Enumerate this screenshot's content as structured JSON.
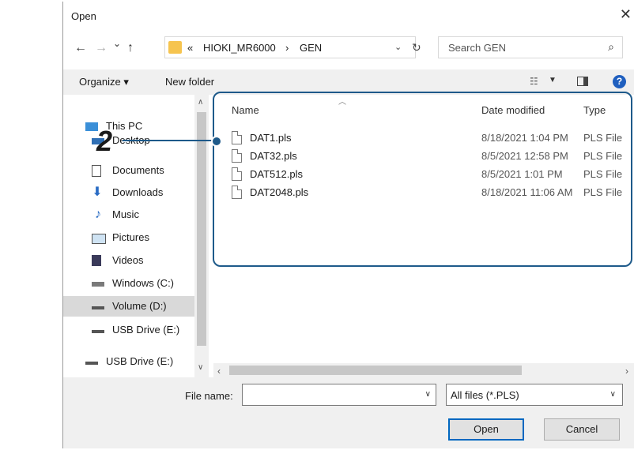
{
  "window": {
    "title": "Open",
    "close_glyph": "✕"
  },
  "nav": {
    "back": "←",
    "forward": "→",
    "recent": "⌄",
    "up": "↑"
  },
  "address": {
    "overflow": "«",
    "crumbs": [
      "HIOKI_MR6000",
      "GEN"
    ],
    "separator": "›",
    "dropdown": "⌄",
    "refresh": "↻"
  },
  "search": {
    "placeholder": "Search GEN",
    "icon": "search-icon"
  },
  "toolbar": {
    "organize": "Organize ▾",
    "new_folder": "New folder",
    "help": "?"
  },
  "sidebar": {
    "items": [
      {
        "label": "This PC",
        "icon": "pc-icon"
      },
      {
        "label": "Desktop",
        "icon": "desktop-icon"
      },
      {
        "label": "Documents",
        "icon": "documents-icon"
      },
      {
        "label": "Downloads",
        "icon": "downloads-icon"
      },
      {
        "label": "Music",
        "icon": "music-icon"
      },
      {
        "label": "Pictures",
        "icon": "pictures-icon"
      },
      {
        "label": "Videos",
        "icon": "videos-icon"
      },
      {
        "label": "Windows (C:)",
        "icon": "drive-c-icon"
      },
      {
        "label": "Volume (D:)",
        "icon": "drive-icon",
        "selected": true
      },
      {
        "label": "USB Drive (E:)",
        "icon": "usb-drive-icon"
      },
      {
        "label": "USB Drive (E:)",
        "icon": "usb-drive-icon"
      }
    ]
  },
  "files": {
    "columns": [
      "Name",
      "Date modified",
      "Type"
    ],
    "rows": [
      {
        "name": "DAT1.pls",
        "date": "8/18/2021 1:04 PM",
        "type": "PLS File"
      },
      {
        "name": "DAT32.pls",
        "date": "8/5/2021 12:58 PM",
        "type": "PLS File"
      },
      {
        "name": "DAT512.pls",
        "date": "8/5/2021 1:01 PM",
        "type": "PLS File"
      },
      {
        "name": "DAT2048.pls",
        "date": "8/18/2021 11:06 AM",
        "type": "PLS File"
      }
    ]
  },
  "bottom": {
    "filename_label": "File name:",
    "filename_value": "",
    "filter": "All files (*.PLS)",
    "open": "Open",
    "cancel": "Cancel"
  },
  "annotation": {
    "number": "2",
    "color": "#1e5a8a"
  }
}
